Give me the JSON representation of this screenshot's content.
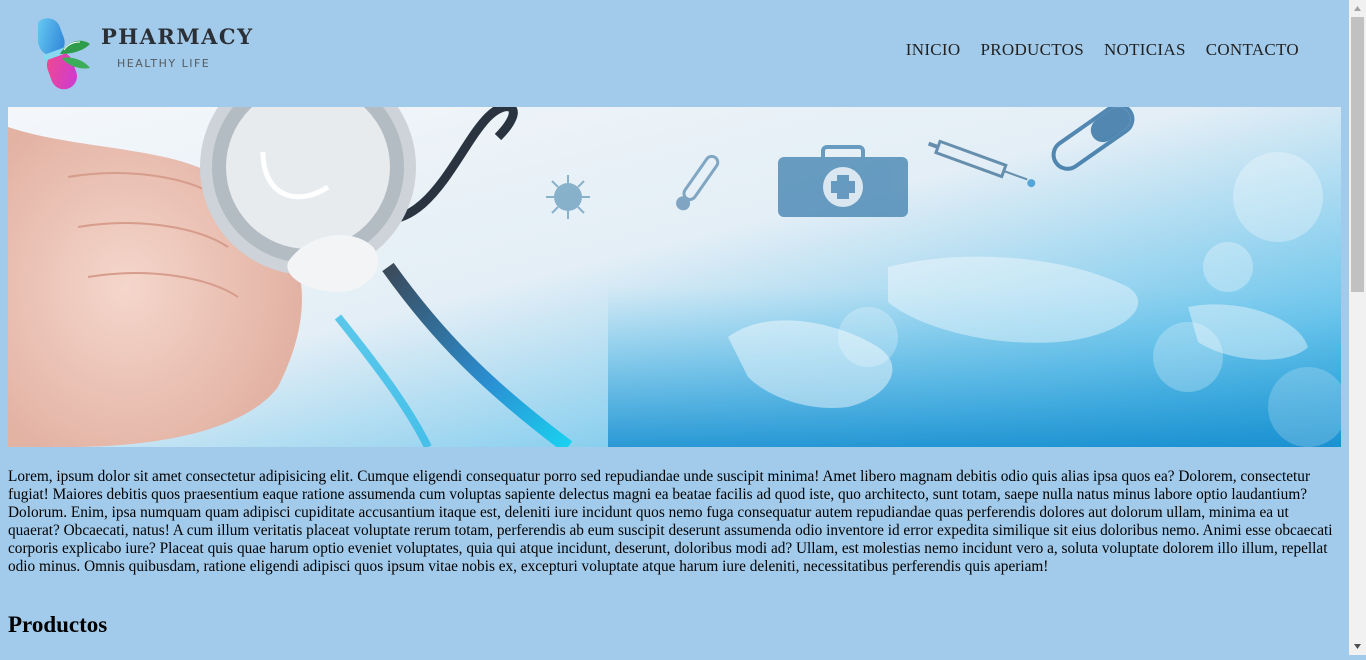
{
  "logo": {
    "title": "PHARMACY",
    "subtitle": "HEALTHY LIFE"
  },
  "nav": {
    "items": [
      {
        "label": "INICIO"
      },
      {
        "label": "PRODUCTOS"
      },
      {
        "label": "NOTICIAS"
      },
      {
        "label": "CONTACTO"
      }
    ]
  },
  "hero": {
    "icons": [
      "stethoscope-icon",
      "thermometer-icon",
      "medical-kit-icon",
      "syringe-icon",
      "pill-icon",
      "world-map"
    ]
  },
  "intro_text": "Lorem, ipsum dolor sit amet consectetur adipisicing elit. Cumque eligendi consequatur porro sed repudiandae unde suscipit minima! Amet libero magnam debitis odio quis alias ipsa quos ea? Dolorem, consectetur fugiat! Maiores debitis quos praesentium eaque ratione assumenda cum voluptas sapiente delectus magni ea beatae facilis ad quod iste, quo architecto, sunt totam, saepe nulla natus minus labore optio laudantium? Dolorum. Enim, ipsa numquam quam adipisci cupiditate accusantium itaque est, deleniti iure incidunt quos nemo fuga consequatur autem repudiandae quas perferendis dolores aut dolorum ullam, minima ea ut quaerat? Obcaecati, natus! A cum illum veritatis placeat voluptate rerum totam, perferendis ab eum suscipit deserunt assumenda odio inventore id error expedita similique sit eius doloribus nemo. Animi esse obcaecati corporis explicabo iure? Placeat quis quae harum optio eveniet voluptates, quia qui atque incidunt, deserunt, doloribus modi ad? Ullam, est molestias nemo incidunt vero a, soluta voluptate dolorem illo illum, repellat odio minus. Omnis quibusdam, ratione eligendi adipisci quos ipsum vitae nobis ex, excepturi voluptate atque harum iure deleniti, necessitatibus perferendis quis aperiam!",
  "section_heading": "Productos",
  "colors": {
    "background": "#a2cbeb",
    "accent_blue": "#1fa3d9",
    "logo_pink": "#e8397f"
  }
}
